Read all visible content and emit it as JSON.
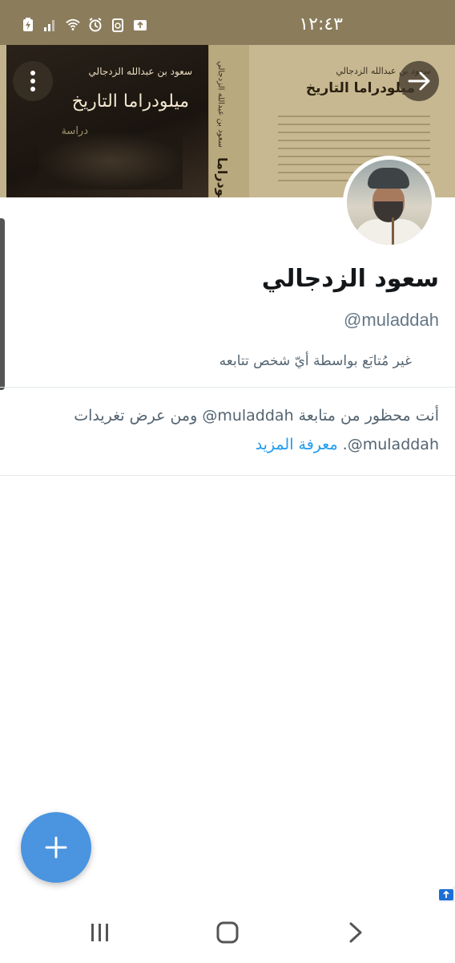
{
  "status_bar": {
    "time": "١٢:٤٣",
    "icons": [
      "battery-charging-icon",
      "signal-icon",
      "wifi-icon",
      "alarm-icon",
      "recycle-icon",
      "upload-icon"
    ]
  },
  "banner": {
    "front_author": "سعود بن عبدالله الزدجالي",
    "front_title": "ميلودراما التاريخ",
    "front_subtitle": "دراسة",
    "back_author": "سعود بن عبدالله الزدجالي",
    "back_title": "ميلودراما التاريخ",
    "spine_author": "سعود بن عبدالله الزدجالي",
    "spine_title": "ميلودراما"
  },
  "profile": {
    "name": "سعود الزدجالي",
    "handle": "@muladdah",
    "not_followed": "غير مُتابَع بواسطة أيّ شخص تتابعه"
  },
  "blocked": {
    "message": "أنت محظور من متابعة muladdah@ ومن عرض تغريدات muladdah@.",
    "learn_more": "معرفة المزيد"
  },
  "colors": {
    "status_bar": "#8b7d5c",
    "accent": "#1d9bf0",
    "fab": "#4a94e0"
  }
}
